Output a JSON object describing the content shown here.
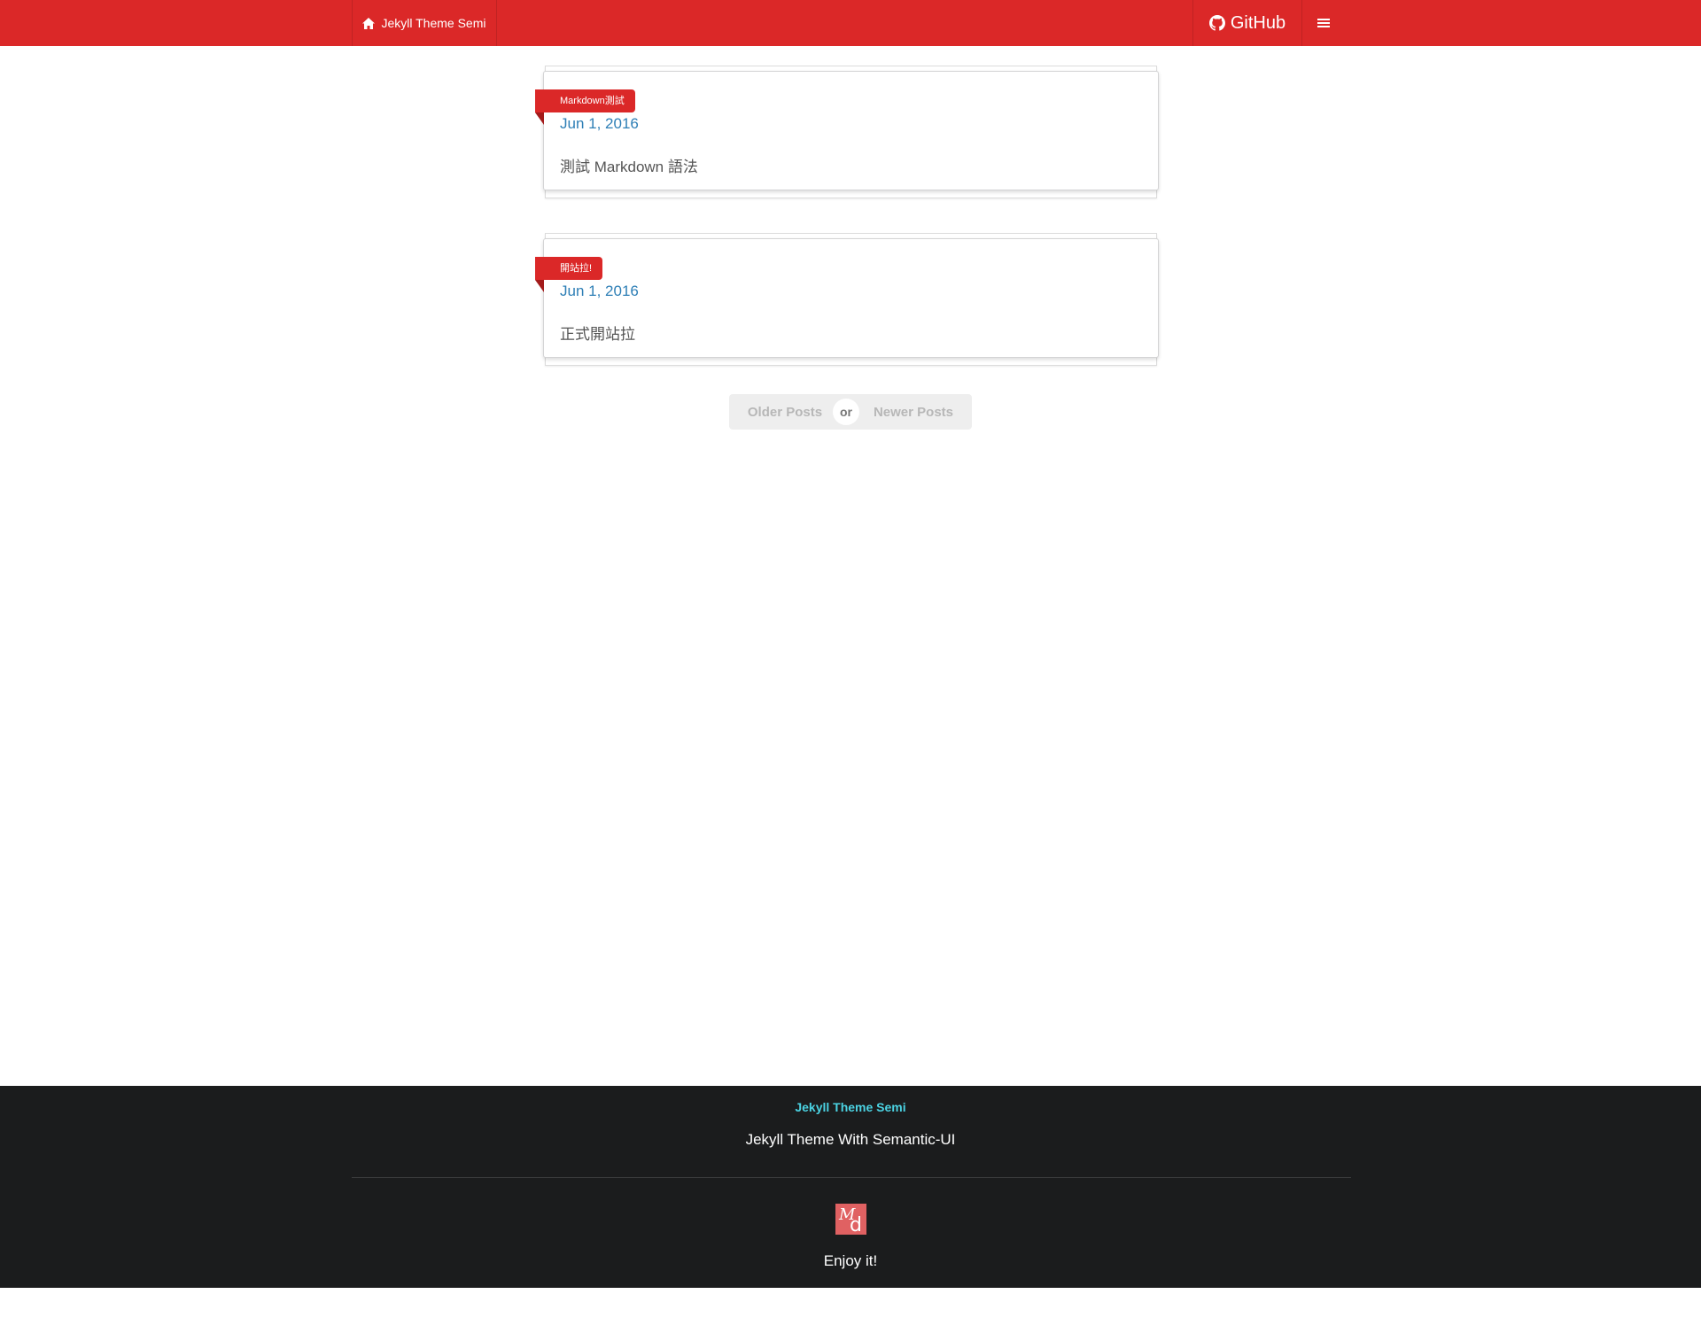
{
  "nav": {
    "brand_label": "Jekyll Theme Semi",
    "github_label": "GitHub",
    "accent_color": "#db2828",
    "icons": {
      "brand": "home-icon",
      "github": "github-icon",
      "menu": "hamburger-menu-icon"
    }
  },
  "posts": [
    {
      "tag": "Markdown測試",
      "date": "Jun 1, 2016",
      "excerpt": "測試 Markdown 語法"
    },
    {
      "tag": "開站拉!",
      "date": "Jun 1, 2016",
      "excerpt": "正式開站拉"
    }
  ],
  "pagination": {
    "older_label": "Older Posts",
    "or_label": "or",
    "newer_label": "Newer Posts"
  },
  "footer": {
    "title": "Jekyll Theme Semi",
    "subtitle": "Jekyll Theme With Semantic-UI",
    "logo_letters": [
      "M",
      "d"
    ],
    "enjoy": "Enjoy it!"
  }
}
